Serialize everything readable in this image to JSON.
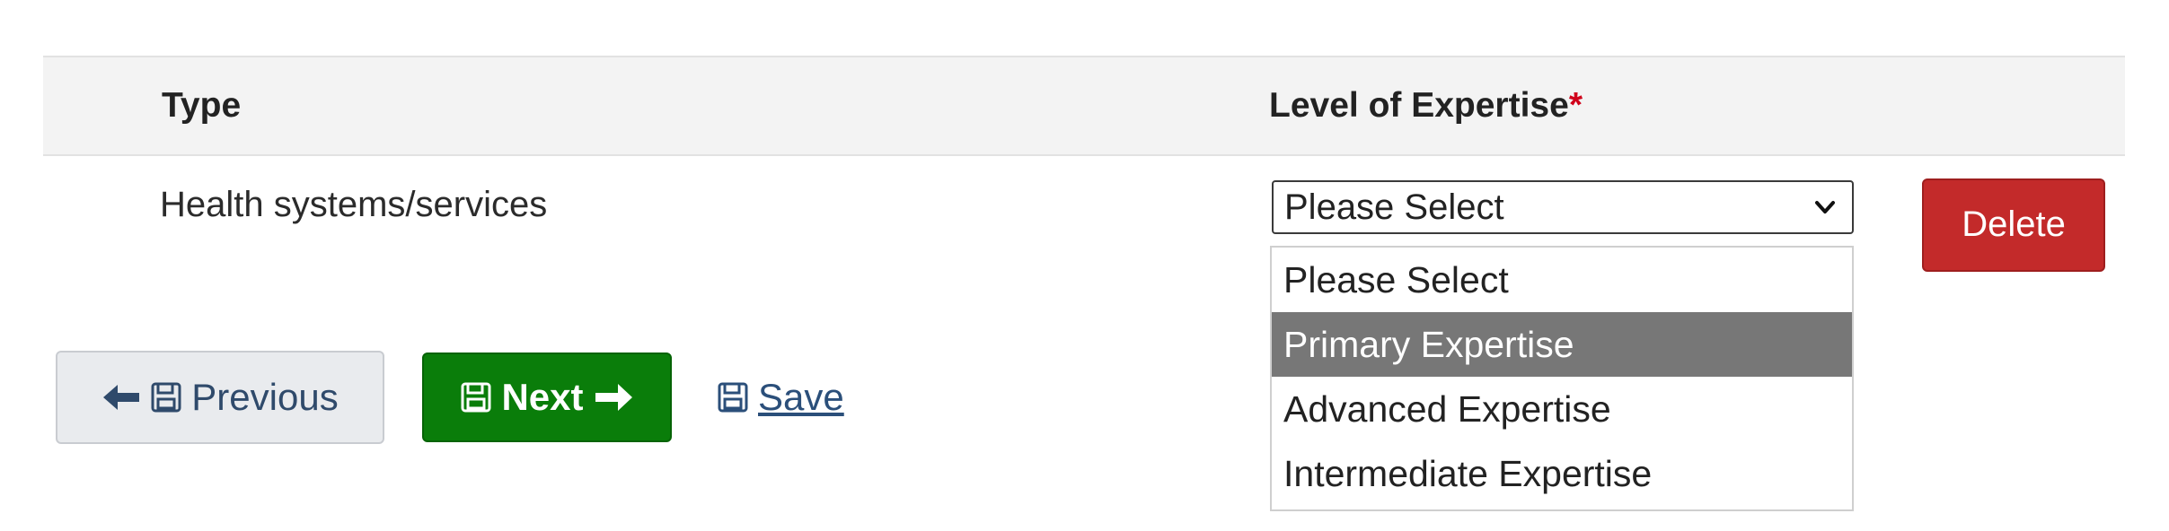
{
  "table": {
    "columns": {
      "type": "Type",
      "level": "Level of Expertise",
      "required_mark": "*"
    },
    "rows": [
      {
        "type": "Health systems/services",
        "level_selected": "Please Select",
        "delete_label": "Delete"
      }
    ]
  },
  "dropdown": {
    "options": [
      "Please Select",
      "Primary Expertise",
      "Advanced Expertise",
      "Intermediate Expertise"
    ],
    "highlighted_index": 1
  },
  "nav": {
    "previous_label": "Previous",
    "next_label": "Next",
    "save_label": "Save"
  },
  "icons": {
    "previous": [
      "arrow-left-icon",
      "save-icon"
    ],
    "next": [
      "save-icon",
      "arrow-right-icon"
    ],
    "save": [
      "save-icon"
    ],
    "select": [
      "chevron-down-icon"
    ]
  },
  "colors": {
    "delete": "#c32a2a",
    "next": "#0a7d0a",
    "highlight": "#777777",
    "required": "#d0021b",
    "link": "#2b4f7a"
  }
}
